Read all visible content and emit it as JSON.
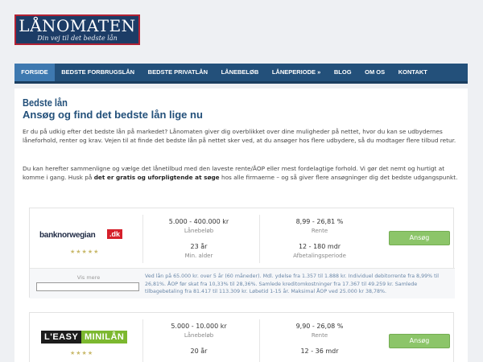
{
  "logo": {
    "title": "LÅNOMATEN",
    "tagline": "Din vej til det bedste lån"
  },
  "nav": {
    "items": [
      "FORSIDE",
      "BEDSTE FORBRUGSLÅN",
      "BEDSTE PRIVATLÅN",
      "LÅNEBELØB",
      "LÅNEPERIODE »",
      "BLOG",
      "OM OS",
      "KONTAKT"
    ]
  },
  "page": {
    "title": "Bedste lån",
    "subtitle": "Ansøg og find det bedste lån lige nu",
    "para1": "Er du på udkig efter det bedste lån på markedet? Lånomaten giver dig overblikket over dine muligheder på nettet, hvor du kan se udbydernes låneforhold, renter og krav. Vejen til at finde det bedste lån på nettet sker ved, at du ansøger hos flere udbydere, så du modtager flere tilbud retur.",
    "para2_start": "Du kan herefter sammenligne og vælge det lånetilbud med den laveste rente/ÅOP eller mest fordelagtige forhold. Vi gør det nemt og hurtigt at komme i gang. Husk på ",
    "para2_bold": "det er gratis og uforpligtende at søge",
    "para2_end": " hos alle firmaerne – og så giver flere ansøgninger dig det bedste udgangspunkt."
  },
  "lenders": [
    {
      "logo_text_a": "banknorwegian",
      "logo_text_b": ".dk",
      "stars": "★★★★★",
      "amount": "5.000 - 400.000 kr",
      "amount_label": "Lånebeløb",
      "rate": "8,99 - 26,81 %",
      "rate_label": "Rente",
      "age": "23 år",
      "age_label": "Min. alder",
      "period": "12 - 180 mdr",
      "period_label": "Afbetalingsperiode",
      "apply_label": "Ansøg",
      "more_label": "Vis mere",
      "details": "Ved lån på 65.000 kr. over 5 år (60 måneder). Mdl. ydelse fra 1.357 til 1.888 kr. Individuel debitorrente fra 8,99% til 26,81%. ÅOP før skat fra 10,33% til 28,36%. Samlede kreditomkostninger fra 17.367 til 49.259 kr. Samlede tilbagebetaling fra 81.417 til 113.309 kr. Løbetid 1-15 år. Maksimal ÅOP ved 25.000 kr 38,78%."
    },
    {
      "logo_text_a": "L'EASY",
      "logo_text_b": "MINILÅN",
      "stars": "★★★★",
      "amount": "5.000 - 10.000 kr",
      "amount_label": "Lånebeløb",
      "rate": "9,90 - 26,08 %",
      "rate_label": "Rente",
      "age": "20 år",
      "period": "12 - 36 mdr",
      "apply_label": "Ansøg"
    }
  ],
  "colors": {
    "nav_bg": "#23507a",
    "nav_active": "#3e79b0",
    "heading": "#23507a",
    "apply_button": "#8cc569",
    "logo_border": "#b22234",
    "easy_green": "#7cb82f"
  }
}
